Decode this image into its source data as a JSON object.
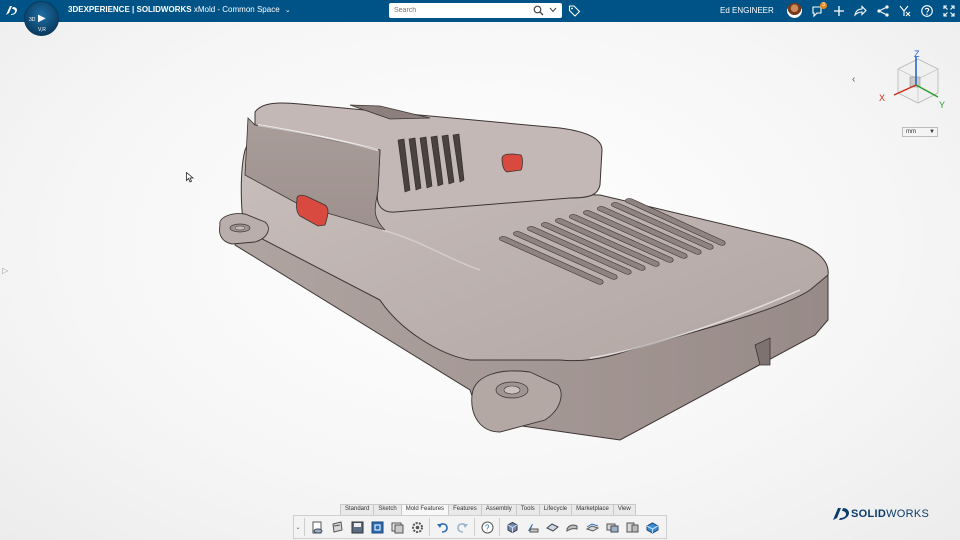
{
  "header": {
    "brand_bold": "3DEXPERIENCE | SOLIDWORKS",
    "app_context": "xMold - Common Space",
    "compass_labels": {
      "top": "",
      "left": "3D",
      "right": "",
      "bottom": "V,R"
    },
    "user_name": "Ed ENGINEER",
    "notification_count": "3"
  },
  "search": {
    "placeholder": "Search",
    "value": ""
  },
  "viewport": {
    "units": "mm",
    "triad": {
      "x": "X",
      "y": "Y",
      "z": "Z"
    }
  },
  "command_tabs": [
    {
      "label": "Standard"
    },
    {
      "label": "Sketch"
    },
    {
      "label": "Mold Features",
      "active": true
    },
    {
      "label": "Features"
    },
    {
      "label": "Assembly"
    },
    {
      "label": "Tools"
    },
    {
      "label": "Lifecycle"
    },
    {
      "label": "Marketplace"
    },
    {
      "label": "View"
    }
  ],
  "toolbar_icons": [
    "new-document-icon",
    "open-icon",
    "save-icon",
    "rebuild-icon",
    "options-icon",
    "settings-icon",
    "undo-icon",
    "redo-icon",
    "help-icon",
    "view-cube-icon",
    "mold-tool-icon",
    "surface-icon",
    "shutoff-icon",
    "parting-line-icon",
    "core-icon",
    "cavity-icon",
    "tooling-split-icon"
  ],
  "footer": {
    "logo_text_bold": "SOLID",
    "logo_text_thin": "WORKS"
  },
  "colors": {
    "topbar": "#005386",
    "part_body": "#b8aca8",
    "button_insert": "#d64a3e",
    "brand_blue": "#0a3b6b"
  }
}
